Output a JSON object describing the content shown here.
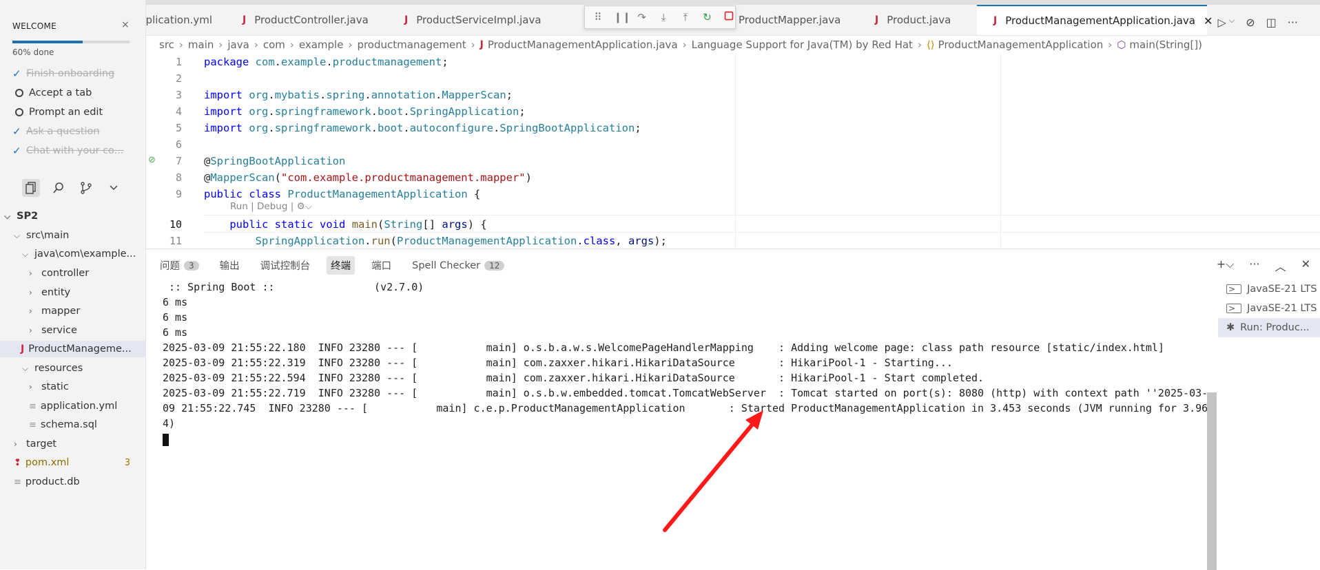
{
  "welcome": {
    "title": "WELCOME",
    "close": "×",
    "progress": 0.6,
    "progress_text": "60% done",
    "tasks": [
      {
        "label": "Finish onboarding",
        "done": true
      },
      {
        "label": "Accept a tab",
        "done": false
      },
      {
        "label": "Prompt an edit",
        "done": false
      },
      {
        "label": "Ask a question",
        "done": true
      },
      {
        "label": "Chat with your co...",
        "done": true
      }
    ]
  },
  "explorer": {
    "items": [
      {
        "label": "SP2",
        "type": "root"
      },
      {
        "label": "src\\main",
        "type": "folder-open"
      },
      {
        "label": "java\\com\\example...",
        "type": "folder-open"
      },
      {
        "label": "controller",
        "type": "folder"
      },
      {
        "label": "entity",
        "type": "folder"
      },
      {
        "label": "mapper",
        "type": "folder"
      },
      {
        "label": "service",
        "type": "folder"
      },
      {
        "label": "ProductManageme...",
        "type": "java"
      },
      {
        "label": "resources",
        "type": "folder-open"
      },
      {
        "label": "static",
        "type": "folder"
      },
      {
        "label": "application.yml",
        "type": "file"
      },
      {
        "label": "schema.sql",
        "type": "file"
      },
      {
        "label": "target",
        "type": "folder"
      },
      {
        "label": "pom.xml",
        "type": "xml",
        "badge": "3"
      },
      {
        "label": "product.db",
        "type": "file"
      }
    ]
  },
  "tabs": [
    {
      "label": "plication.yml"
    },
    {
      "label": "ProductController.java"
    },
    {
      "label": "ProductServiceImpl.java"
    },
    {
      "label": "ProductMapper.java"
    },
    {
      "label": "Product.java"
    },
    {
      "label": "ProductManagementApplication.java",
      "active": true
    }
  ],
  "breadcrumb": [
    "src",
    "main",
    "java",
    "com",
    "example",
    "productmanagement",
    "ProductManagementApplication.java",
    "Language Support for Java(TM) by Red Hat",
    "ProductManagementApplication",
    "main(String[])"
  ],
  "code": {
    "line_numbers": [
      "1",
      "2",
      "3",
      "4",
      "5",
      "6",
      "7",
      "8",
      "9",
      "10",
      "11"
    ],
    "lines": [
      "package com.example.productmanagement;",
      "",
      "import org.mybatis.spring.annotation.MapperScan;",
      "import org.springframework.boot.SpringApplication;",
      "import org.springframework.boot.autoconfigure.SpringBootApplication;",
      "",
      "@SpringBootApplication",
      "@MapperScan(\"com.example.productmanagement.mapper\")",
      "public class ProductManagementApplication {",
      "    public static void main(String[] args) {",
      "        SpringApplication.run(ProductManagementApplication.class, args);"
    ],
    "codelens": "Run | Debug |"
  },
  "panel": {
    "tabs": [
      {
        "label": "问题",
        "badge": "3"
      },
      {
        "label": "输出"
      },
      {
        "label": "调试控制台"
      },
      {
        "label": "终端",
        "active": true
      },
      {
        "label": "端口"
      },
      {
        "label": "Spell Checker",
        "badge": "12"
      }
    ],
    "terminal_lines": [
      " :: Spring Boot ::                (v2.7.0)",
      "6 ms",
      "6 ms",
      "6 ms",
      "2025-03-09 21:55:22.180  INFO 23280 --- [           main] o.s.b.a.w.s.WelcomePageHandlerMapping    : Adding welcome page: class path resource [static/index.html]",
      "2025-03-09 21:55:22.319  INFO 23280 --- [           main] com.zaxxer.hikari.HikariDataSource       : HikariPool-1 - Starting...",
      "2025-03-09 21:55:22.594  INFO 23280 --- [           main] com.zaxxer.hikari.HikariDataSource       : HikariPool-1 - Start completed.",
      "2025-03-09 21:55:22.719  INFO 23280 --- [           main] o.s.b.w.embedded.tomcat.TomcatWebServer  : Tomcat started on port(s): 8080 (http) with context path ''2025-03-",
      "09 21:55:22.745  INFO 23280 --- [           main] c.e.p.ProductManagementApplication       : Started ProductManagementApplication in 3.453 seconds (JVM running for 3.96",
      "4)"
    ],
    "terminals": [
      {
        "label": "JavaSE-21 LTS"
      },
      {
        "label": "JavaSE-21 LTS"
      },
      {
        "label": "Run: Produc...",
        "selected": true
      }
    ]
  },
  "colors": {
    "accent": "#1f6fb5",
    "annotation_arrow": "#ff1a1a",
    "java_icon": "#c5283d"
  }
}
